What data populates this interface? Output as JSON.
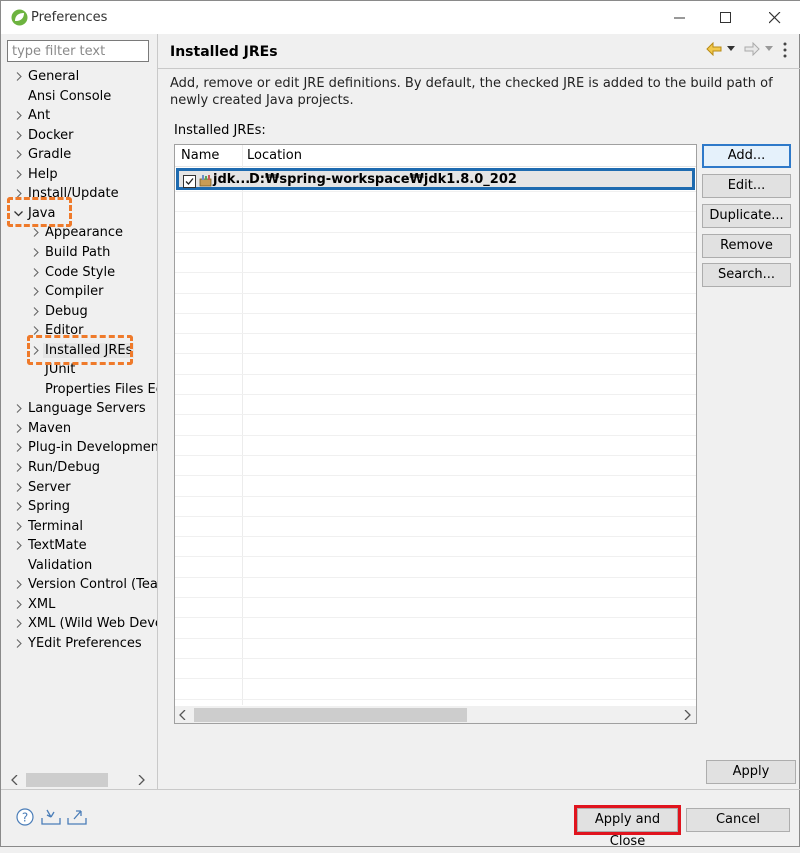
{
  "window": {
    "title": "Preferences"
  },
  "filter": {
    "placeholder": "type filter text"
  },
  "tree": [
    {
      "label": "General",
      "level": 0,
      "arrow": "right"
    },
    {
      "label": "Ansi Console",
      "level": 0,
      "arrow": "none"
    },
    {
      "label": "Ant",
      "level": 0,
      "arrow": "right"
    },
    {
      "label": "Docker",
      "level": 0,
      "arrow": "right"
    },
    {
      "label": "Gradle",
      "level": 0,
      "arrow": "right"
    },
    {
      "label": "Help",
      "level": 0,
      "arrow": "right"
    },
    {
      "label": "Install/Update",
      "level": 0,
      "arrow": "right"
    },
    {
      "label": "Java",
      "level": 0,
      "arrow": "down"
    },
    {
      "label": "Appearance",
      "level": 1,
      "arrow": "right"
    },
    {
      "label": "Build Path",
      "level": 1,
      "arrow": "right"
    },
    {
      "label": "Code Style",
      "level": 1,
      "arrow": "right"
    },
    {
      "label": "Compiler",
      "level": 1,
      "arrow": "right"
    },
    {
      "label": "Debug",
      "level": 1,
      "arrow": "right"
    },
    {
      "label": "Editor",
      "level": 1,
      "arrow": "right"
    },
    {
      "label": "Installed JREs",
      "level": 1,
      "arrow": "right",
      "selected": true
    },
    {
      "label": "JUnit",
      "level": 1,
      "arrow": "none"
    },
    {
      "label": "Properties Files Ec",
      "level": 1,
      "arrow": "none"
    },
    {
      "label": "Language Servers",
      "level": 0,
      "arrow": "right"
    },
    {
      "label": "Maven",
      "level": 0,
      "arrow": "right"
    },
    {
      "label": "Plug-in Developmen",
      "level": 0,
      "arrow": "right"
    },
    {
      "label": "Run/Debug",
      "level": 0,
      "arrow": "right"
    },
    {
      "label": "Server",
      "level": 0,
      "arrow": "right"
    },
    {
      "label": "Spring",
      "level": 0,
      "arrow": "right"
    },
    {
      "label": "Terminal",
      "level": 0,
      "arrow": "right"
    },
    {
      "label": "TextMate",
      "level": 0,
      "arrow": "right"
    },
    {
      "label": "Validation",
      "level": 0,
      "arrow": "none"
    },
    {
      "label": "Version Control (Tea",
      "level": 0,
      "arrow": "right"
    },
    {
      "label": "XML",
      "level": 0,
      "arrow": "right"
    },
    {
      "label": "XML (Wild Web Deve",
      "level": 0,
      "arrow": "right"
    },
    {
      "label": "YEdit Preferences",
      "level": 0,
      "arrow": "right"
    }
  ],
  "page": {
    "title": "Installed JREs",
    "description": "Add, remove or edit JRE definitions. By default, the checked JRE is added to the build path of newly created Java projects.",
    "list_label": "Installed JREs:"
  },
  "table": {
    "columns": [
      "Name",
      "Location"
    ],
    "rows": [
      {
        "name": "jdk...",
        "location": "D:₩spring-workspace₩jdk1.8.0_202",
        "checked": true
      }
    ]
  },
  "side_buttons": {
    "add": "Add...",
    "edit": "Edit...",
    "duplicate": "Duplicate...",
    "remove": "Remove",
    "search": "Search..."
  },
  "footer": {
    "apply": "Apply",
    "apply_close": "Apply and Close",
    "cancel": "Cancel"
  },
  "colors": {
    "highlight_orange": "#ef7a2a",
    "highlight_red": "#e0141e",
    "selection_blue": "#1e6bb0"
  }
}
